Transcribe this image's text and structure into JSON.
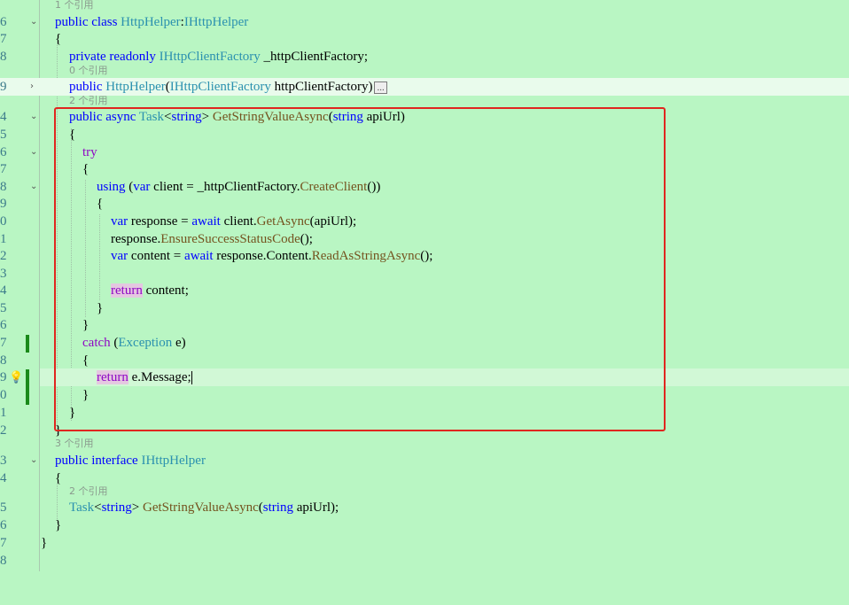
{
  "ref_text": {
    "one": "1 个引用",
    "zero": "0 个引用",
    "two": "2 个引用",
    "three": "3 个引用"
  },
  "line_numbers": {
    "l06": "6",
    "l07": "7",
    "l08": "8",
    "l09": "9",
    "l14": "4",
    "l15": "5",
    "l16": "6",
    "l17": "7",
    "l18": "8",
    "l19": "9",
    "l20": "0",
    "l21": "1",
    "l22": "2",
    "l23": "3",
    "l24": "4",
    "l25": "5",
    "l26": "6",
    "l27": "7",
    "l28": "8",
    "l29": "9",
    "l30": "0",
    "l31": "1",
    "l32": "2",
    "l33": "3",
    "l34": "4",
    "l35": "5",
    "l36": "6",
    "l37": "7",
    "l38": "8"
  },
  "tokens": {
    "public": "public",
    "class": "class",
    "interface": "interface",
    "private": "private",
    "readonly": "readonly",
    "async": "async",
    "string": "string",
    "var": "var",
    "using": "using",
    "try": "try",
    "catch": "catch",
    "await": "await",
    "return": "return",
    "HttpHelper": "HttpHelper",
    "IHttpHelper": "IHttpHelper",
    "IHttpClientFactory": "IHttpClientFactory",
    "Task": "Task",
    "Exception": "Exception",
    "GetStringValueAsync": "GetStringValueAsync",
    "CreateClient": "CreateClient",
    "GetAsync": "GetAsync",
    "EnsureSuccessStatusCode": "EnsureSuccessStatusCode",
    "ReadAsStringAsync": "ReadAsStringAsync",
    "field": " _httpClientFactory;",
    "ctor_param": " httpClientFactory)",
    "collapsed": "...",
    "apiUrl_param": " apiUrl)",
    "apiUrl_param_semi": " apiUrl);",
    "client_eq": " client = _httpClientFactory.",
    "response_eq": " response = ",
    "client_dot": " client.",
    "apiUrl_call": "(apiUrl);",
    "response_dot": "response.",
    "call_end": "();",
    "content_eq": " content = ",
    "response_content": " response.Content.",
    "content_ret": " content;",
    "e_paren": " e)",
    "e_message": " e.Message;",
    "colon": ":",
    "lt": "<",
    "gt": ">",
    "paren_open": "(",
    "paren_open_space": " (",
    "double_close": "())",
    "brace_open": "{",
    "brace_close": "}"
  }
}
